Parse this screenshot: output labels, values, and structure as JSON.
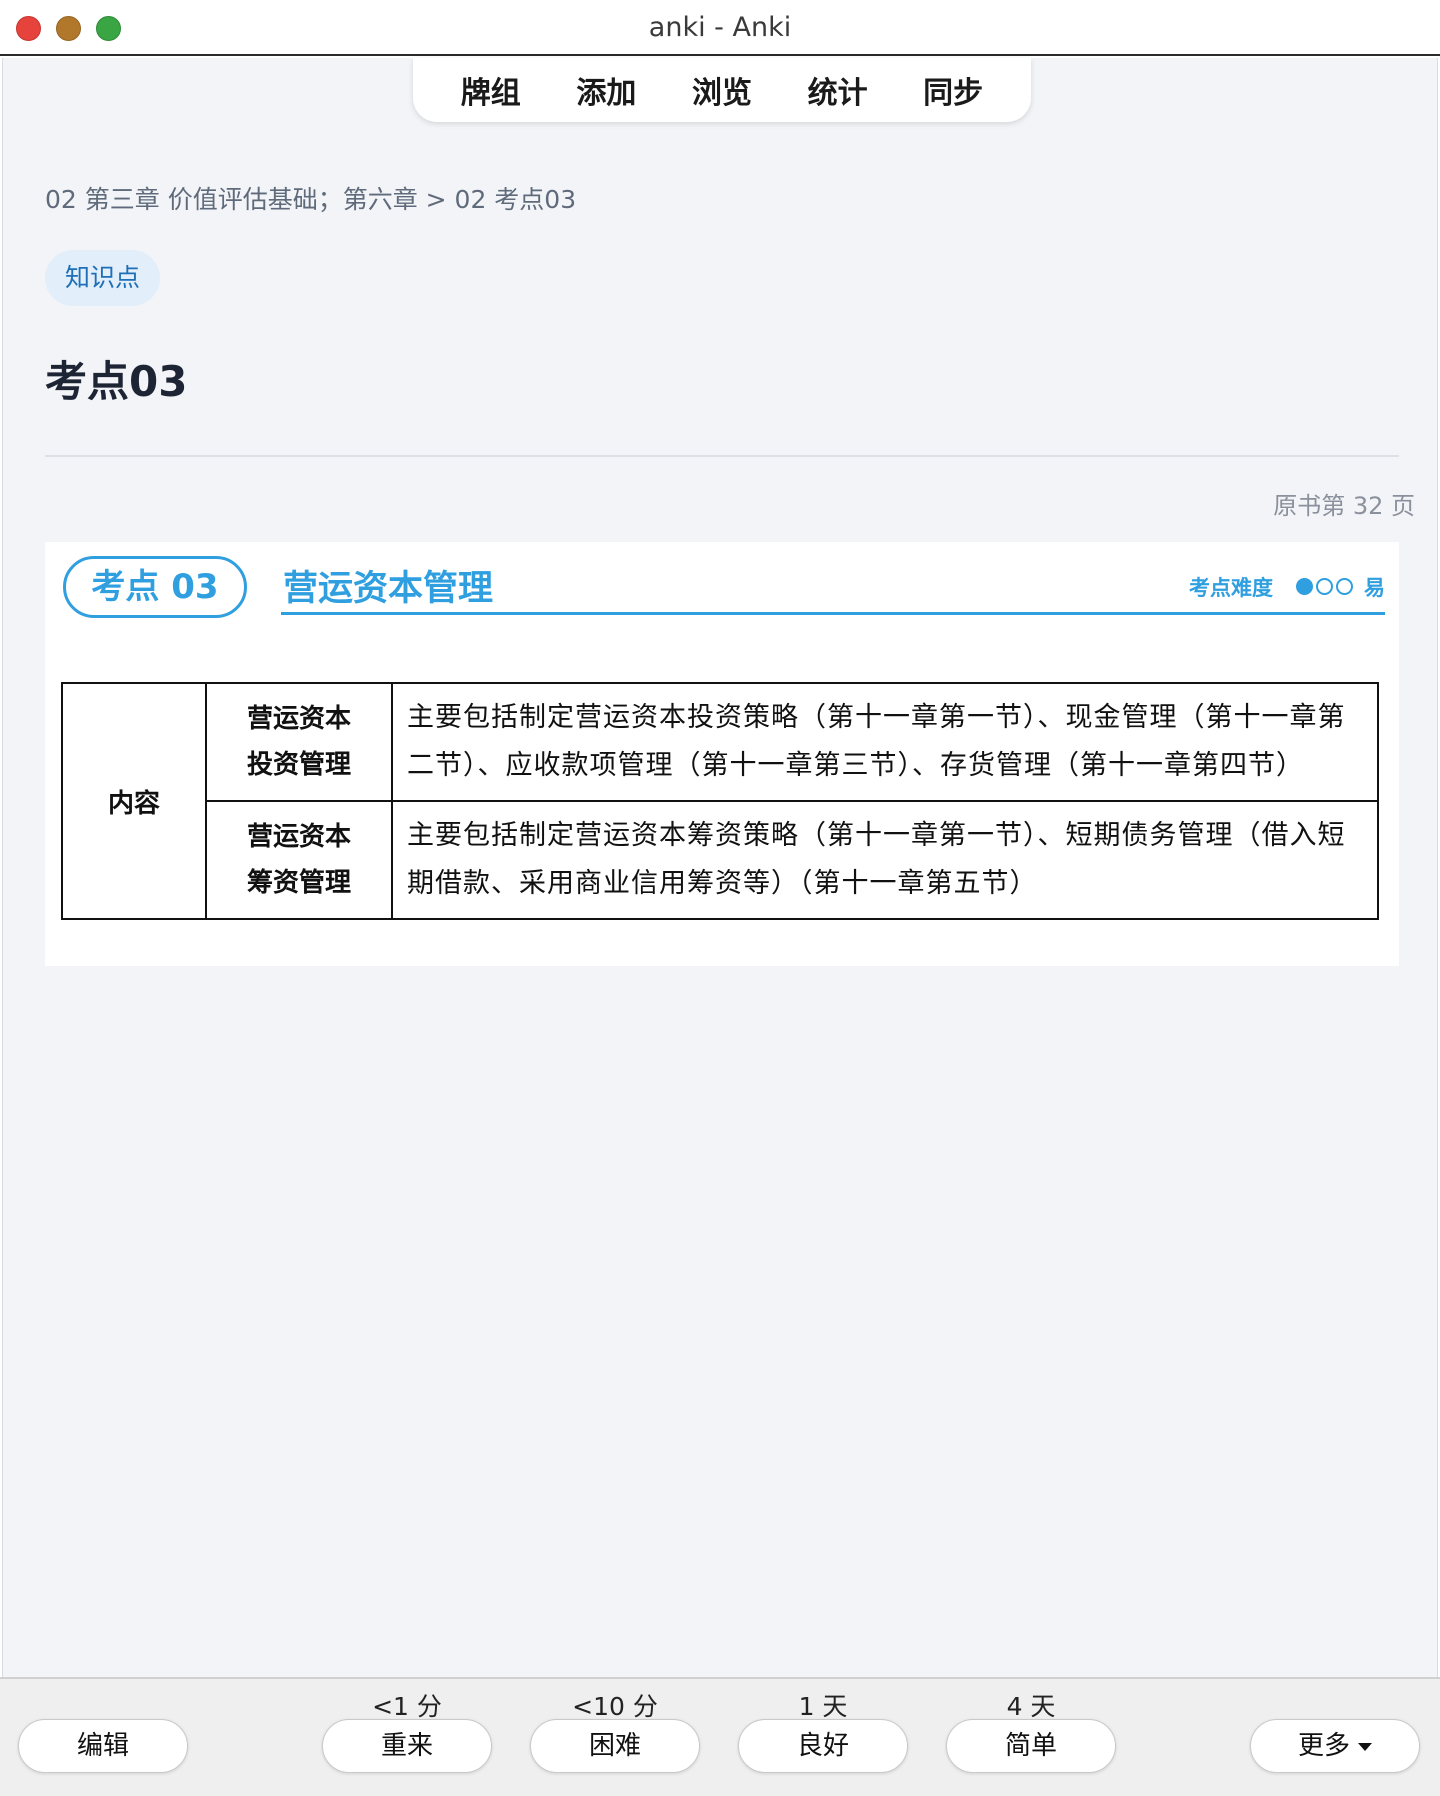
{
  "window": {
    "title": "anki - Anki"
  },
  "toolbar": {
    "items": [
      "牌组",
      "添加",
      "浏览",
      "统计",
      "同步"
    ]
  },
  "card": {
    "breadcrumb": "02 第三章 价值评估基础；第六章 > 02 考点03",
    "tag": "知识点",
    "title": "考点03",
    "page_ref": "原书第 32 页"
  },
  "book": {
    "badge": "考点 03",
    "heading": "营运资本管理",
    "difficulty_label": "考点难度",
    "difficulty_level": 1,
    "difficulty_max": 3,
    "difficulty_text": "易",
    "table": {
      "row_header": "内容",
      "rows": [
        {
          "sub1": "营运资本",
          "sub2": "投资管理",
          "text": "主要包括制定营运资本投资策略（第十一章第一节）、现金管理（第十一章第二节）、应收款项管理（第十一章第三节）、存货管理（第十一章第四节）"
        },
        {
          "sub1": "营运资本",
          "sub2": "筹资管理",
          "text": "主要包括制定营运资本筹资策略（第十一章第一节）、短期债务管理（借入短期借款、采用商业信用筹资等）（第十一章第五节）"
        }
      ]
    }
  },
  "answer_bar": {
    "edit": "编辑",
    "more": "更多",
    "buttons": [
      {
        "interval": "<1 分",
        "label": "重来"
      },
      {
        "interval": "<10 分",
        "label": "困难"
      },
      {
        "interval": "1 天",
        "label": "良好"
      },
      {
        "interval": "4 天",
        "label": "简单"
      }
    ]
  }
}
